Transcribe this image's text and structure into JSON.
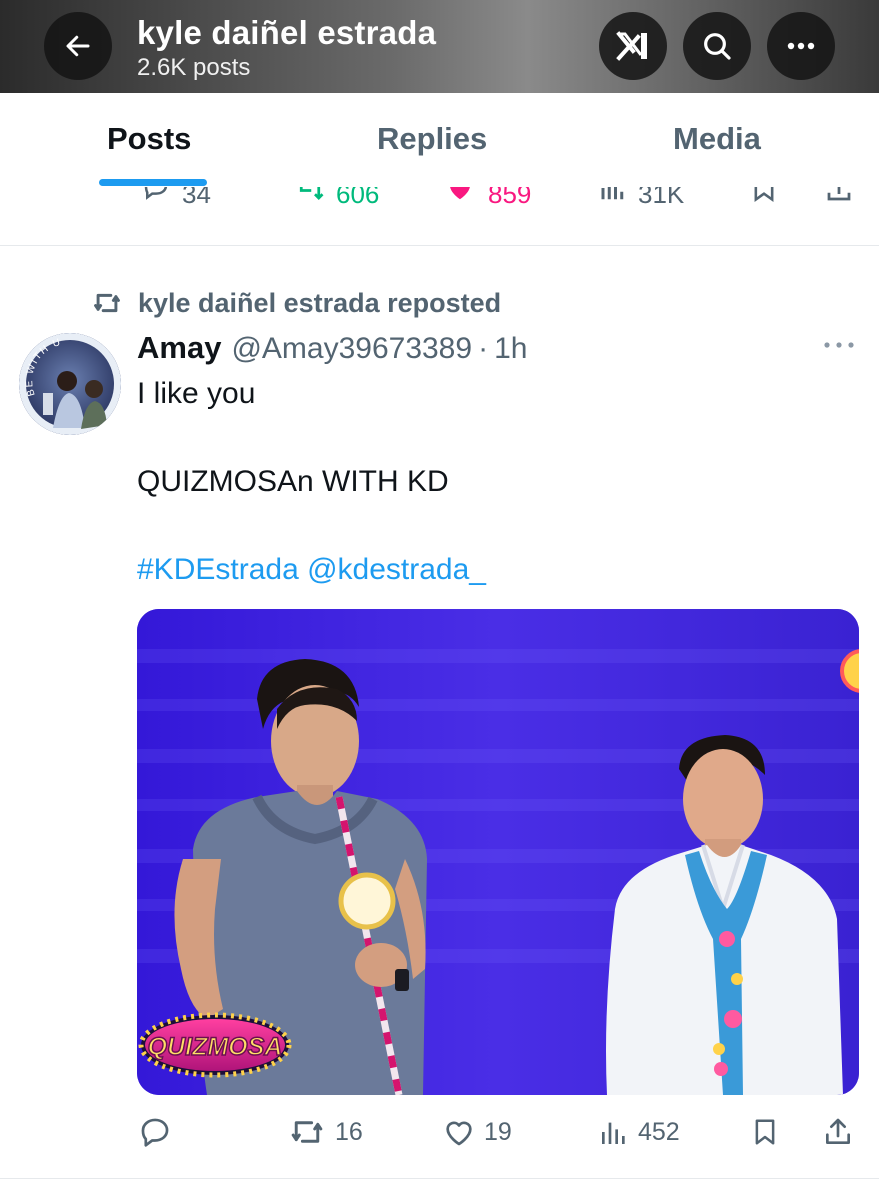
{
  "header": {
    "name": "kyle daiñel estrada",
    "post_count": "2.6K posts",
    "icons": [
      "back-arrow-icon",
      "grok-icon",
      "search-icon",
      "more-icon"
    ]
  },
  "tabs": [
    {
      "label": "Posts",
      "active": true
    },
    {
      "label": "Replies",
      "active": false
    },
    {
      "label": "Media",
      "active": false
    }
  ],
  "previous_post_actions": {
    "reply_count": "34",
    "repost_count": "606",
    "like_count": "859",
    "view_count": "31K"
  },
  "tweet": {
    "repost_label": "kyle daiñel estrada reposted",
    "author_name": "Amay",
    "author_handle": "@Amay39673389",
    "separator": "·",
    "time": "1h",
    "avatar_text": "BE WITH U",
    "line1": "I like you",
    "line2": "QUIZMOSAn WITH KD",
    "hashtag": "#KDEstrada",
    "mention": "@kdestrada_",
    "media_logo_text": "QUIZMOSA",
    "actions": {
      "reply_count": "",
      "repost_count": "16",
      "like_count": "19",
      "view_count": "452"
    }
  },
  "colors": {
    "accent": "#1d9bf0",
    "secondary_text": "#536471",
    "primary_text": "#0f1419",
    "repost_green": "#00ba7c",
    "like_pink": "#f91880",
    "media_background": "#3b2bd8"
  }
}
